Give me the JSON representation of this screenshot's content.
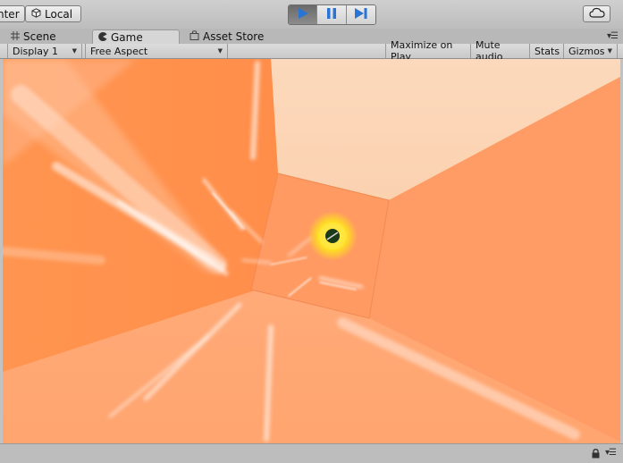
{
  "toolbar": {
    "pivot_label": "nter",
    "local_label": "Local",
    "pivot_icon": "pivot-center",
    "local_icon": "cube-icon",
    "play_active": true,
    "cloud_icon": "cloud-icon"
  },
  "tabs": [
    {
      "label": "Scene",
      "icon": "grid-icon",
      "active": false
    },
    {
      "label": "Game",
      "icon": "pacman-icon",
      "active": true
    },
    {
      "label": "Asset Store",
      "icon": "bag-icon",
      "active": false
    }
  ],
  "game_bar": {
    "display": "Display 1",
    "aspect": "Free Aspect",
    "maximize": "Maximize on Play",
    "mute": "Mute audio",
    "stats": "Stats",
    "gizmos": "Gizmos"
  },
  "colors": {
    "accent_blue": "#2a74d4",
    "scene_orange": "#ff9a5c",
    "scene_light": "#fcd6b8",
    "target_yellow": "#ffe020",
    "target_core": "#1a3a1a"
  }
}
